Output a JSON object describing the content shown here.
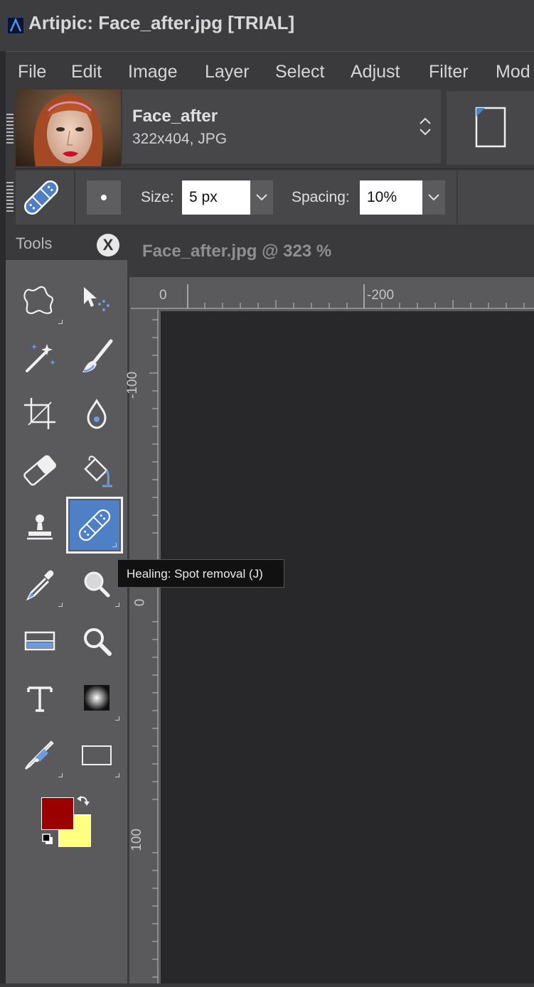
{
  "window": {
    "title": "Artipic: Face_after.jpg [TRIAL]",
    "logo_icon": "artipic-logo-icon"
  },
  "menu": {
    "items": [
      "File",
      "Edit",
      "Image",
      "Layer",
      "Select",
      "Adjust",
      "Filter",
      "Mod"
    ]
  },
  "document": {
    "name": "Face_after",
    "meta": "322x404,  JPG",
    "thumbnail_icon": "portrait-thumbnail"
  },
  "tool_options": {
    "tool_icon": "bandage-icon",
    "size_label": "Size:",
    "size_value": "5 px",
    "spacing_label": "Spacing:",
    "spacing_value": "10%"
  },
  "tools_panel": {
    "title": "Tools",
    "close_label": "X",
    "tools": [
      {
        "name": "lasso-icon"
      },
      {
        "name": "selection-arrow-icon"
      },
      {
        "name": "magic-wand-icon"
      },
      {
        "name": "brush-icon"
      },
      {
        "name": "crop-icon"
      },
      {
        "name": "drop-icon"
      },
      {
        "name": "eraser-icon"
      },
      {
        "name": "paint-bucket-icon"
      },
      {
        "name": "stamp-icon"
      },
      {
        "name": "bandage-icon",
        "selected": true
      },
      {
        "name": "eyedropper-icon"
      },
      {
        "name": "magnifier-glass-icon"
      },
      {
        "name": "scanner-icon"
      },
      {
        "name": "zoom-icon"
      },
      {
        "name": "text-icon",
        "glyph": "T"
      },
      {
        "name": "gradient-icon"
      },
      {
        "name": "pen-icon"
      },
      {
        "name": "rectangle-icon"
      }
    ],
    "foreground_color": "#9b0000",
    "background_color": "#ffff80"
  },
  "tooltip": {
    "text": "Healing: Spot removal (J)"
  },
  "canvas": {
    "title": "Face_after.jpg @ 323 %",
    "ruler_top_labels": [
      "0",
      "-200"
    ],
    "ruler_left_labels": [
      "-100",
      "0",
      "100"
    ],
    "background": "#28282a"
  }
}
